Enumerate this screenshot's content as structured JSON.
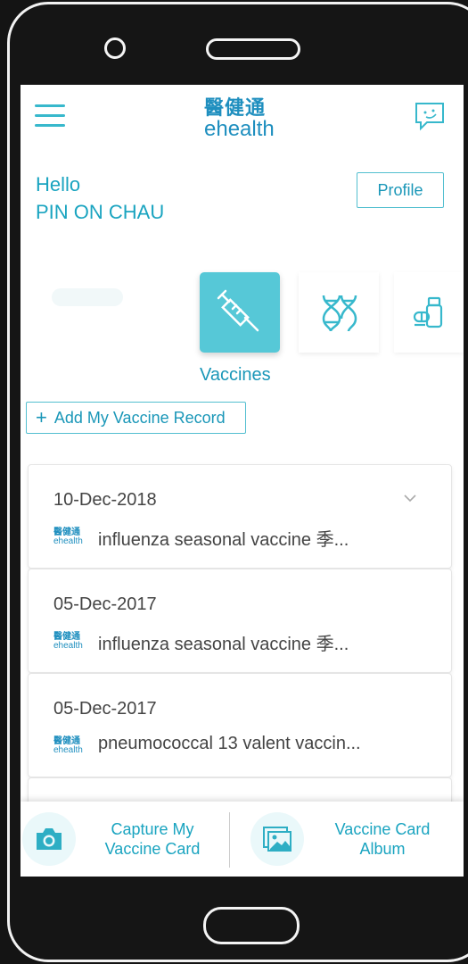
{
  "app": {
    "logo_zh": "醫健通",
    "logo_en": "ehealth"
  },
  "greeting": {
    "hello": "Hello",
    "name": "PIN ON CHAU"
  },
  "profile_button": "Profile",
  "category": {
    "active_label": "Vaccines"
  },
  "add_record_label": "Add My Vaccine Record",
  "records": [
    {
      "date": "10-Dec-2018",
      "vaccine": "influenza seasonal vaccine 季..."
    },
    {
      "date": "05-Dec-2017",
      "vaccine": "influenza seasonal vaccine 季..."
    },
    {
      "date": "05-Dec-2017",
      "vaccine": "pneumococcal 13 valent vaccin..."
    }
  ],
  "bottom_bar": {
    "capture_line1": "Capture My",
    "capture_line2": "Vaccine Card",
    "album_line1": "Vaccine Card",
    "album_line2": "Album"
  },
  "colors": {
    "accent": "#1aa4c0",
    "tile_active": "#56c8d7"
  },
  "icons": [
    "menu-icon",
    "chat-icon",
    "syringe-icon",
    "dna-icon",
    "medicine-icon",
    "chevron-down-icon",
    "camera-icon",
    "album-icon"
  ]
}
